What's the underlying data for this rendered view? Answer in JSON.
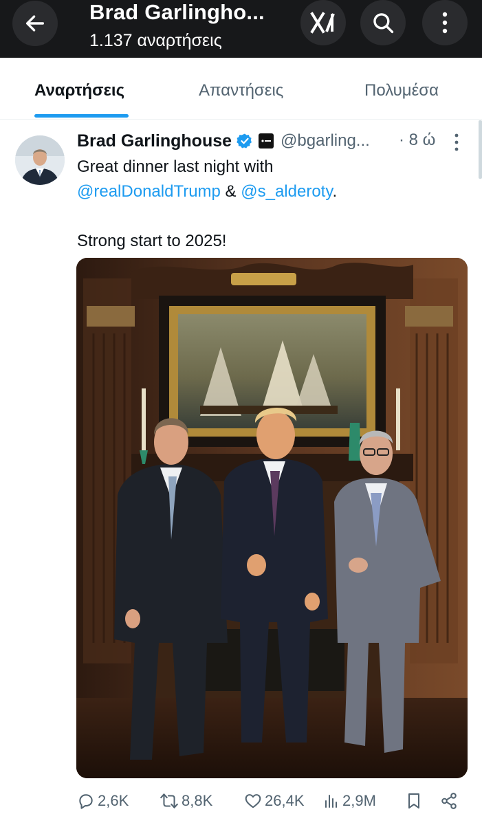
{
  "header": {
    "title": "Brad Garlingho...",
    "subtitle": "1.137 αναρτήσεις"
  },
  "tabs": [
    {
      "label": "Αναρτήσεις",
      "active": true
    },
    {
      "label": "Απαντήσεις",
      "active": false
    },
    {
      "label": "Πολυμέσα",
      "active": false
    }
  ],
  "post": {
    "author_name": "Brad Garlinghouse",
    "handle": "@bgarling...",
    "time": "· 8 ώ",
    "text_line1": "Great dinner last night with",
    "mention1": "@realDonaldTrump",
    "amp": " & ",
    "mention2": "@s_alderoty",
    "period": ".",
    "text_line3": "Strong start to 2025!",
    "stats": {
      "replies": "2,6K",
      "reposts": "8,8K",
      "likes": "26,4K",
      "views": "2,9M"
    }
  },
  "colors": {
    "accent": "#1d9bf0",
    "header_bg": "#17181a",
    "muted": "#536471"
  }
}
